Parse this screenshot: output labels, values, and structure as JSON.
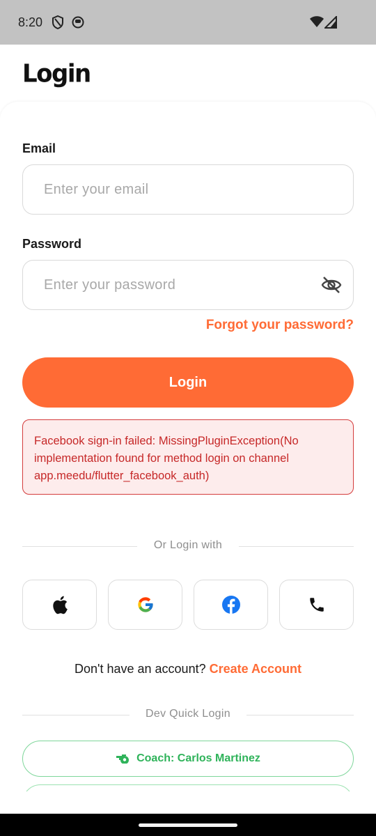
{
  "status_bar": {
    "time": "8:20"
  },
  "header": {
    "title": "Login"
  },
  "form": {
    "email_label": "Email",
    "email_placeholder": "Enter your email",
    "email_value": "",
    "password_label": "Password",
    "password_placeholder": "Enter your password",
    "password_value": "",
    "forgot_label": "Forgot your password?",
    "login_label": "Login"
  },
  "error": {
    "message": "Facebook sign-in failed: MissingPluginException(No implementation found for method login on channel app.meedu/flutter_facebook_auth)"
  },
  "social": {
    "divider_label": "Or Login with",
    "buttons": [
      {
        "icon": "apple-icon"
      },
      {
        "icon": "google-icon"
      },
      {
        "icon": "facebook-icon"
      },
      {
        "icon": "phone-icon"
      }
    ]
  },
  "signup": {
    "prompt": "Don't have an account?",
    "link": "Create Account"
  },
  "dev": {
    "divider_label": "Dev Quick Login",
    "buttons": [
      {
        "label": "Coach: Carlos Martinez",
        "icon": "whistle-icon"
      }
    ]
  },
  "colors": {
    "accent": "#ff6b35",
    "error": "#c62828",
    "dev_green": "#2fb35a"
  }
}
